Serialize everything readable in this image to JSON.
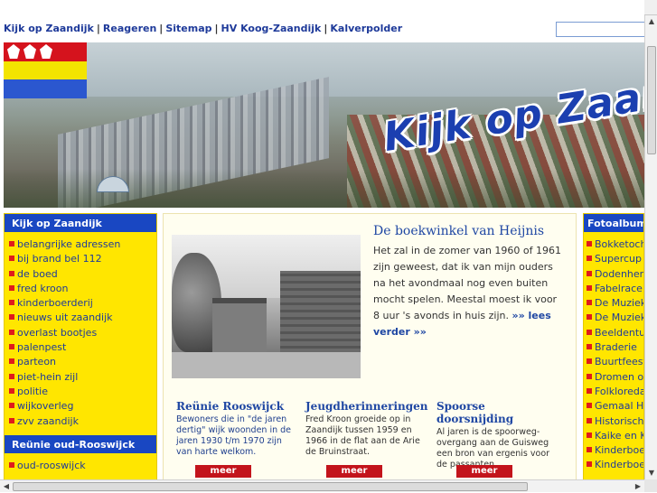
{
  "topnav": {
    "links": [
      "Kijk op Zaandijk",
      "Reageren",
      "Sitemap",
      "HV Koog-Zaandijk",
      "Kalverpolder"
    ],
    "separator": "|"
  },
  "banner": {
    "title": "Kijk op Zaan"
  },
  "leftcol": {
    "heading1": "Kijk op Zaandijk",
    "items": [
      "belangrijke adressen",
      "bij brand bel 112",
      "de boed",
      "fred kroon",
      "kinderboerderij",
      "nieuws uit zaandijk",
      "overlast bootjes",
      "palenpest",
      "parteon",
      "piet-hein zijl",
      "politie",
      "wijkoverleg",
      "zvv zaandijk"
    ],
    "heading2": "Reünie oud-Rooswijck",
    "items2": [
      "oud-rooswijck"
    ]
  },
  "article": {
    "title": "De boekwinkel van Heijnis",
    "text": "Het zal in de zomer van 1960 of 1961 zijn geweest, dat ik van mijn ouders na het avondmaal nog even buiten mocht spelen. Meestal moest ik voor 8 uur 's avonds in huis zijn.",
    "more": "»» lees verder »»"
  },
  "teasers": [
    {
      "title": "Reünie Rooswijck",
      "text": "Bewoners die in \"de jaren dertig\" wijk woonden in de jaren 1930 t/m 1970 zijn van harte welkom.",
      "button": "meer"
    },
    {
      "title": "Jeugdherinneringen",
      "text": "Fred Kroon groeide op in Zaandijk tussen 1959 en 1966 in de flat aan de Arie de Bruinstraat.",
      "button": "meer"
    },
    {
      "title": "Spoorse doorsnijding",
      "text": "Al jaren is de spoorweg-overgang aan de Guisweg een bron van ergenis voor de passanten.",
      "button": "meer"
    }
  ],
  "rightcol": {
    "heading": "Fotoalbums",
    "items": [
      "Bokketocht",
      "Supercup F",
      "Dodenherd",
      "Fabelrace in",
      "De Muziekt",
      "De Muziekt",
      "Beeldentui",
      "Braderie",
      "Buurtfeest I",
      "Dromen ove",
      "Folkloredag",
      "Gemaal He",
      "Historische",
      "Kaike en Ko",
      "Kinderboei",
      "Kinderboei"
    ]
  },
  "colors": {
    "nav_blue": "#1e3a9a",
    "heading_bg": "#1947c2",
    "column_bg": "#ffe600",
    "bullet": "#e01b1b",
    "button": "#c3141b"
  },
  "icons": [
    "scroll-up-icon",
    "scroll-down-icon",
    "scroll-left-icon",
    "scroll-right-icon"
  ]
}
